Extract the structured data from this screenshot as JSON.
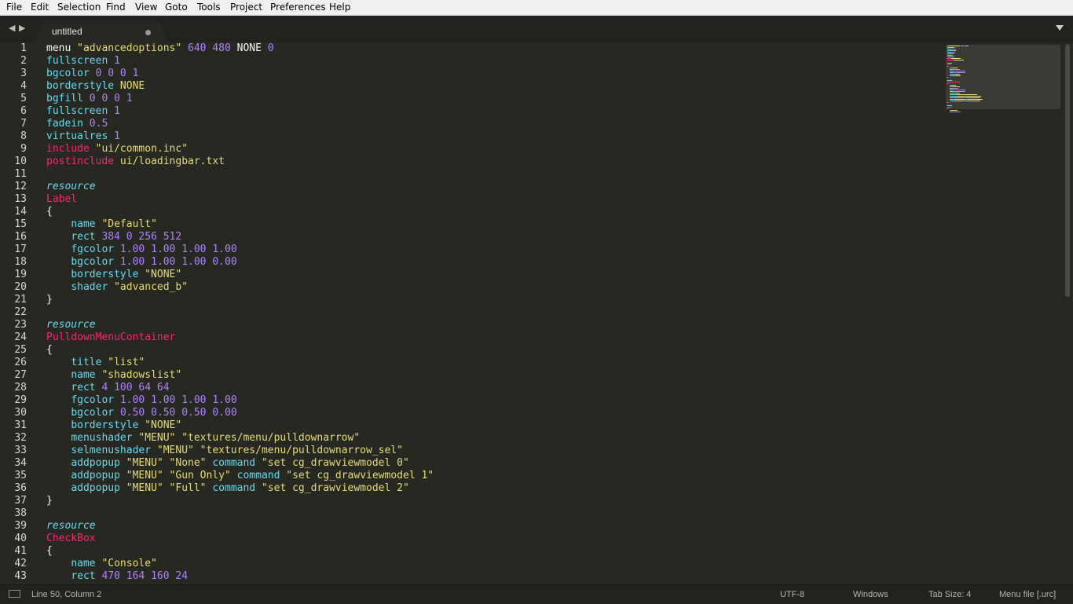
{
  "menu": [
    "File",
    "Edit",
    "Selection",
    "Find",
    "View",
    "Goto",
    "Tools",
    "Project",
    "Preferences",
    "Help"
  ],
  "tab": {
    "title": "untitled",
    "dirty": true
  },
  "editor": {
    "line_numbers": [
      "1",
      "2",
      "3",
      "4",
      "5",
      "6",
      "7",
      "8",
      "9",
      "10",
      "11",
      "12",
      "13",
      "14",
      "15",
      "16",
      "17",
      "18",
      "19",
      "20",
      "21",
      "22",
      "23",
      "24",
      "25",
      "26",
      "27",
      "28",
      "29",
      "30",
      "31",
      "32",
      "33",
      "34",
      "35",
      "36",
      "37",
      "38",
      "39",
      "40",
      "41",
      "42",
      "43"
    ],
    "lines": [
      [
        [
          "t",
          "menu "
        ],
        [
          "s",
          "\"advancedoptions\""
        ],
        [
          "t",
          " "
        ],
        [
          "n",
          "640 480"
        ],
        [
          "t",
          " NONE "
        ],
        [
          "n",
          "0"
        ]
      ],
      [
        [
          "k",
          "fullscreen "
        ],
        [
          "n",
          "1"
        ]
      ],
      [
        [
          "k",
          "bgcolor "
        ],
        [
          "n",
          "0 0 0 1"
        ]
      ],
      [
        [
          "k",
          "borderstyle "
        ],
        [
          "s",
          "NONE"
        ]
      ],
      [
        [
          "k",
          "bgfill "
        ],
        [
          "n",
          "0 0 0 1"
        ]
      ],
      [
        [
          "k",
          "fullscreen "
        ],
        [
          "n",
          "1"
        ]
      ],
      [
        [
          "k",
          "fadein "
        ],
        [
          "n",
          "0.5"
        ]
      ],
      [
        [
          "k",
          "virtualres "
        ],
        [
          "n",
          "1"
        ]
      ],
      [
        [
          "p",
          "include "
        ],
        [
          "s",
          "\"ui/common.inc\""
        ]
      ],
      [
        [
          "p",
          "postinclude "
        ],
        [
          "s",
          "ui/loadingbar.txt"
        ]
      ],
      [],
      [
        [
          "i",
          "resource"
        ]
      ],
      [
        [
          "p",
          "Label"
        ]
      ],
      [
        [
          "t",
          "{"
        ]
      ],
      [
        [
          "t",
          "    "
        ],
        [
          "k",
          "name "
        ],
        [
          "s",
          "\"Default\""
        ]
      ],
      [
        [
          "t",
          "    "
        ],
        [
          "k",
          "rect "
        ],
        [
          "n",
          "384 0 256 512"
        ]
      ],
      [
        [
          "t",
          "    "
        ],
        [
          "k",
          "fgcolor "
        ],
        [
          "n",
          "1.00 1.00 1.00 1.00"
        ]
      ],
      [
        [
          "t",
          "    "
        ],
        [
          "k",
          "bgcolor "
        ],
        [
          "n",
          "1.00 1.00 1.00 0.00"
        ]
      ],
      [
        [
          "t",
          "    "
        ],
        [
          "k",
          "borderstyle "
        ],
        [
          "s",
          "\"NONE\""
        ]
      ],
      [
        [
          "t",
          "    "
        ],
        [
          "k",
          "shader "
        ],
        [
          "s",
          "\"advanced_b\""
        ]
      ],
      [
        [
          "t",
          "}"
        ]
      ],
      [],
      [
        [
          "i",
          "resource"
        ]
      ],
      [
        [
          "p",
          "PulldownMenuContainer"
        ]
      ],
      [
        [
          "t",
          "{"
        ]
      ],
      [
        [
          "t",
          "    "
        ],
        [
          "k",
          "title "
        ],
        [
          "s",
          "\"list\""
        ]
      ],
      [
        [
          "t",
          "    "
        ],
        [
          "k",
          "name "
        ],
        [
          "s",
          "\"shadowslist\""
        ]
      ],
      [
        [
          "t",
          "    "
        ],
        [
          "k",
          "rect "
        ],
        [
          "n",
          "4 100 64 64"
        ]
      ],
      [
        [
          "t",
          "    "
        ],
        [
          "k",
          "fgcolor "
        ],
        [
          "n",
          "1.00 1.00 1.00 1.00"
        ]
      ],
      [
        [
          "t",
          "    "
        ],
        [
          "k",
          "bgcolor "
        ],
        [
          "n",
          "0.50 0.50 0.50 0.00"
        ]
      ],
      [
        [
          "t",
          "    "
        ],
        [
          "k",
          "borderstyle "
        ],
        [
          "s",
          "\"NONE\""
        ]
      ],
      [
        [
          "t",
          "    "
        ],
        [
          "k",
          "menushader "
        ],
        [
          "s",
          "\"MENU\" \"textures/menu/pulldownarrow\""
        ]
      ],
      [
        [
          "t",
          "    "
        ],
        [
          "k",
          "selmenushader "
        ],
        [
          "s",
          "\"MENU\" \"textures/menu/pulldownarrow_sel\""
        ]
      ],
      [
        [
          "t",
          "    "
        ],
        [
          "k",
          "addpopup "
        ],
        [
          "s",
          "\"MENU\" \"None\" "
        ],
        [
          "k",
          "command "
        ],
        [
          "s",
          "\"set cg_drawviewmodel 0\""
        ]
      ],
      [
        [
          "t",
          "    "
        ],
        [
          "k",
          "addpopup "
        ],
        [
          "s",
          "\"MENU\" \"Gun Only\" "
        ],
        [
          "k",
          "command "
        ],
        [
          "s",
          "\"set cg_drawviewmodel 1\""
        ]
      ],
      [
        [
          "t",
          "    "
        ],
        [
          "k",
          "addpopup "
        ],
        [
          "s",
          "\"MENU\" \"Full\" "
        ],
        [
          "k",
          "command "
        ],
        [
          "s",
          "\"set cg_drawviewmodel 2\""
        ]
      ],
      [
        [
          "t",
          "}"
        ]
      ],
      [],
      [
        [
          "i",
          "resource"
        ]
      ],
      [
        [
          "p",
          "CheckBox"
        ]
      ],
      [
        [
          "t",
          "{"
        ]
      ],
      [
        [
          "t",
          "    "
        ],
        [
          "k",
          "name "
        ],
        [
          "s",
          "\"Console\""
        ]
      ],
      [
        [
          "t",
          "    "
        ],
        [
          "k",
          "rect "
        ],
        [
          "n",
          "470 164 160 24"
        ]
      ]
    ]
  },
  "status": {
    "position": "Line 50, Column 2",
    "encoding": "UTF-8",
    "line_endings": "Windows",
    "tab_size": "Tab Size: 4",
    "syntax": "Menu file [.urc]"
  }
}
